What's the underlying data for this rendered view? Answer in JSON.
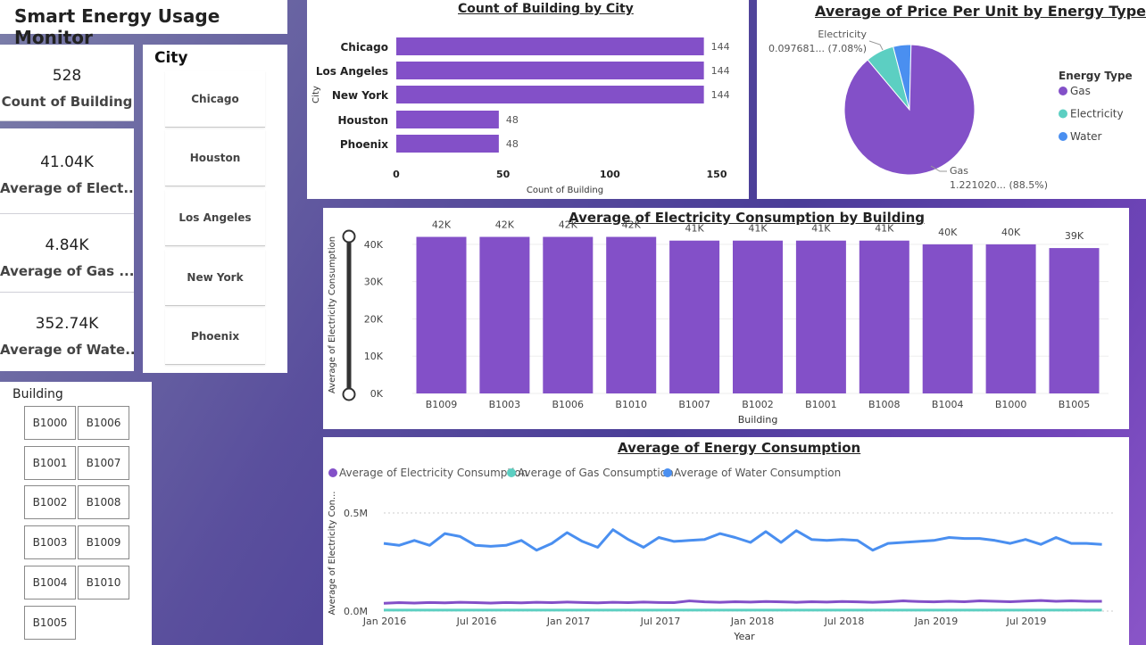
{
  "app_title": "Smart Energy Usage Monitor",
  "kpis": [
    {
      "value": "528",
      "label": "Count of Building"
    },
    {
      "value": "41.04K",
      "label": "Average of Elect..."
    },
    {
      "value": "4.84K",
      "label": "Average of Gas ..."
    },
    {
      "value": "352.74K",
      "label": "Average of Wate..."
    }
  ],
  "city_slicer": {
    "title": "City",
    "items": [
      "Chicago",
      "Houston",
      "Los Angeles",
      "New York",
      "Phoenix"
    ]
  },
  "building_slicer": {
    "title": "Building",
    "items": [
      "B1000",
      "B1006",
      "B1001",
      "B1007",
      "B1002",
      "B1008",
      "B1003",
      "B1009",
      "B1004",
      "B1010",
      "B1005"
    ]
  },
  "colors": {
    "purple": "#8350c8",
    "teal": "#5ccfc2",
    "blue": "#4a8ff0"
  },
  "chart_data": [
    {
      "type": "bar",
      "orientation": "horizontal",
      "title": "Count of Building by City",
      "categories": [
        "Chicago",
        "Los Angeles",
        "New York",
        "Houston",
        "Phoenix"
      ],
      "values": [
        144,
        144,
        144,
        48,
        48
      ],
      "xlabel": "Count of Building",
      "ylabel": "City",
      "xlim": [
        0,
        150
      ],
      "xticks": [
        "0",
        "50",
        "100",
        "150"
      ]
    },
    {
      "type": "pie",
      "title": "Average of Price Per Unit by Energy Type",
      "legend_title": "Energy Type",
      "legend": [
        "Gas",
        "Electricity",
        "Water"
      ],
      "slices": [
        {
          "name": "Gas",
          "percent": 88.5,
          "label": "Gas",
          "value_label": "1.221020... (88.5%)"
        },
        {
          "name": "Electricity",
          "percent": 7.08,
          "label": "Electricity",
          "value_label": "0.097681... (7.08%)"
        },
        {
          "name": "Water",
          "percent": 4.42
        }
      ]
    },
    {
      "type": "bar",
      "title": "Average of Electricity Consumption by Building",
      "categories": [
        "B1009",
        "B1003",
        "B1006",
        "B1010",
        "B1007",
        "B1002",
        "B1001",
        "B1008",
        "B1004",
        "B1000",
        "B1005"
      ],
      "values": [
        42000,
        42000,
        42000,
        42000,
        41000,
        41000,
        41000,
        41000,
        40000,
        40000,
        39000
      ],
      "data_labels": [
        "42K",
        "42K",
        "42K",
        "42K",
        "41K",
        "41K",
        "41K",
        "41K",
        "40K",
        "40K",
        "39K"
      ],
      "xlabel": "Building",
      "ylabel": "Average of Electricity Consumption",
      "ylim": [
        0,
        45000
      ],
      "yticks": [
        "0K",
        "10K",
        "20K",
        "30K",
        "40K"
      ]
    },
    {
      "type": "line",
      "title": "Average of Energy Consumption",
      "xlabel": "Year",
      "ylabel": "Average of Electricity Con...",
      "yticks": [
        "0.0M",
        "0.5M"
      ],
      "ylim": [
        0,
        0.6
      ],
      "xticks": [
        "Jan 2016",
        "Jul 2016",
        "Jan 2017",
        "Jul 2017",
        "Jan 2018",
        "Jul 2018",
        "Jan 2019",
        "Jul 2019"
      ],
      "legend": [
        "Average of Electricity Consumption",
        "Average of Gas Consumption",
        "Average of Water Consumption"
      ],
      "series": [
        {
          "name": "Average of Water Consumption",
          "color": "blue",
          "values": [
            0.345,
            0.335,
            0.36,
            0.335,
            0.395,
            0.38,
            0.335,
            0.33,
            0.335,
            0.36,
            0.31,
            0.345,
            0.4,
            0.355,
            0.325,
            0.415,
            0.365,
            0.325,
            0.375,
            0.355,
            0.36,
            0.365,
            0.395,
            0.375,
            0.35,
            0.405,
            0.35,
            0.41,
            0.365,
            0.36,
            0.365,
            0.36,
            0.31,
            0.345,
            0.35,
            0.355,
            0.36,
            0.375,
            0.37,
            0.37,
            0.36,
            0.345,
            0.365,
            0.34,
            0.375,
            0.345,
            0.345,
            0.34
          ]
        },
        {
          "name": "Average of Electricity Consumption",
          "color": "purple",
          "values": [
            0.04,
            0.043,
            0.041,
            0.044,
            0.042,
            0.045,
            0.043,
            0.041,
            0.044,
            0.042,
            0.045,
            0.043,
            0.046,
            0.044,
            0.042,
            0.045,
            0.043,
            0.046,
            0.044,
            0.043,
            0.052,
            0.047,
            0.045,
            0.048,
            0.046,
            0.049,
            0.047,
            0.045,
            0.048,
            0.046,
            0.049,
            0.047,
            0.045,
            0.048,
            0.052,
            0.049,
            0.047,
            0.05,
            0.048,
            0.052,
            0.05,
            0.048,
            0.051,
            0.054,
            0.05,
            0.052,
            0.05,
            0.05
          ]
        },
        {
          "name": "Average of Gas Consumption",
          "color": "teal",
          "values": [
            0.005,
            0.005,
            0.005,
            0.005,
            0.005,
            0.005,
            0.005,
            0.005,
            0.005,
            0.005,
            0.005,
            0.005,
            0.005,
            0.005,
            0.005,
            0.005,
            0.005,
            0.005,
            0.005,
            0.005,
            0.005,
            0.005,
            0.005,
            0.005,
            0.005,
            0.005,
            0.005,
            0.005,
            0.005,
            0.005,
            0.005,
            0.005,
            0.005,
            0.005,
            0.005,
            0.005,
            0.005,
            0.005,
            0.005,
            0.005,
            0.005,
            0.005,
            0.005,
            0.005,
            0.005,
            0.005,
            0.005,
            0.005
          ]
        }
      ]
    }
  ]
}
